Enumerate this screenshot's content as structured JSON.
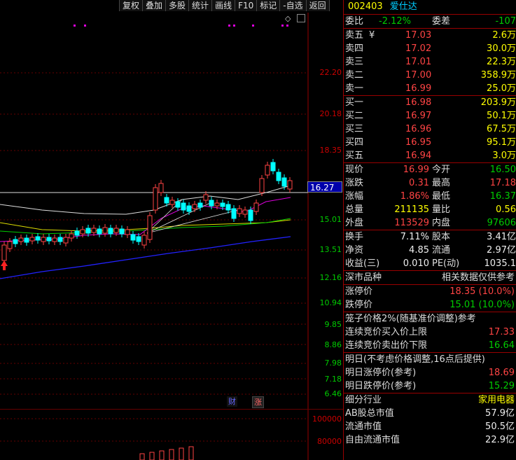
{
  "toolbar": {
    "items": [
      "复权",
      "叠加",
      "多股",
      "统计",
      "画线",
      "F10",
      "标记",
      "-自选",
      "返回"
    ]
  },
  "axis": {
    "price_ticks": [
      "22.20",
      "20.18",
      "18.35",
      "16.27",
      "15.01",
      "13.51",
      "12.16",
      "10.94",
      "9.85",
      "8.86",
      "7.98",
      "7.18",
      "6.46"
    ],
    "current_price": "16.27",
    "volume_ticks": [
      "100000",
      "80000"
    ]
  },
  "badges": {
    "cai": "财",
    "zhang": "涨"
  },
  "stock": {
    "code": "002403",
    "name": "爱仕达"
  },
  "weibi": {
    "label": "委比",
    "value": "-2.12%",
    "label2": "委差",
    "value2": "-107"
  },
  "asks": [
    {
      "label": "卖五",
      "price": "17.03",
      "vol": "2.6万"
    },
    {
      "label": "卖四",
      "price": "17.02",
      "vol": "30.0万"
    },
    {
      "label": "卖三",
      "price": "17.01",
      "vol": "22.3万"
    },
    {
      "label": "卖二",
      "price": "17.00",
      "vol": "358.9万"
    },
    {
      "label": "卖一",
      "price": "16.99",
      "vol": "25.0万"
    }
  ],
  "ask_marker": "¥",
  "bids": [
    {
      "label": "买一",
      "price": "16.98",
      "vol": "203.9万"
    },
    {
      "label": "买二",
      "price": "16.97",
      "vol": "50.1万"
    },
    {
      "label": "买三",
      "price": "16.96",
      "vol": "67.5万"
    },
    {
      "label": "买四",
      "price": "16.95",
      "vol": "95.1万"
    },
    {
      "label": "买五",
      "price": "16.94",
      "vol": "3.0万"
    }
  ],
  "quote": [
    {
      "l1": "现价",
      "v1": "16.99",
      "c1": "red",
      "l2": "今开",
      "v2": "16.50",
      "c2": "grn"
    },
    {
      "l1": "涨跌",
      "v1": "0.31",
      "c1": "red",
      "l2": "最高",
      "v2": "17.18",
      "c2": "red"
    },
    {
      "l1": "涨幅",
      "v1": "1.86%",
      "c1": "red",
      "l2": "最低",
      "v2": "16.37",
      "c2": "grn"
    },
    {
      "l1": "总量",
      "v1": "211135",
      "c1": "yel",
      "l2": "量比",
      "v2": "0.56",
      "c2": "yel"
    },
    {
      "l1": "外盘",
      "v1": "113529",
      "c1": "red",
      "l2": "内盘",
      "v2": "97606",
      "c2": "grn"
    }
  ],
  "fundamentals": [
    {
      "l1": "换手",
      "v1": "7.11%",
      "l2": "股本",
      "v2": "3.41亿"
    },
    {
      "l1": "净资",
      "v1": "4.85",
      "l2": "流通",
      "v2": "2.97亿"
    },
    {
      "l1": "收益(三)",
      "v1": "0.010",
      "l2": "PE(动)",
      "v2": "1035.1"
    }
  ],
  "market": {
    "label": "深市品种",
    "note": "相关数据仅供参考"
  },
  "limits": [
    {
      "label": "涨停价",
      "value": "18.35 (10.0%)",
      "color": "red"
    },
    {
      "label": "跌停价",
      "value": "15.01 (10.0%)",
      "color": "grn"
    }
  ],
  "cage": {
    "title": "笼子价格2%(随基准价调整)参考",
    "rows": [
      {
        "label": "连续竞价买入价上限",
        "value": "17.33",
        "color": "red"
      },
      {
        "label": "连续竞价卖出价下限",
        "value": "16.64",
        "color": "grn"
      }
    ]
  },
  "tomorrow": {
    "title": "明日(不考虑价格调整,16点后提供)",
    "rows": [
      {
        "label": "明日涨停价(参考)",
        "value": "18.69",
        "color": "red"
      },
      {
        "label": "明日跌停价(参考)",
        "value": "15.29",
        "color": "grn"
      }
    ]
  },
  "industry": {
    "label": "细分行业",
    "value": "家用电器",
    "rows": [
      {
        "label": "AB股总市值",
        "value": "57.9亿"
      },
      {
        "label": "流通市值",
        "value": "50.5亿"
      },
      {
        "label": "自由流通市值",
        "value": "22.9亿"
      }
    ]
  },
  "colors": {
    "bg": "#000000",
    "up": "#ff4444",
    "down": "#00ffff",
    "ma_blue": "#2222ff",
    "panel_border": "#990000"
  }
}
